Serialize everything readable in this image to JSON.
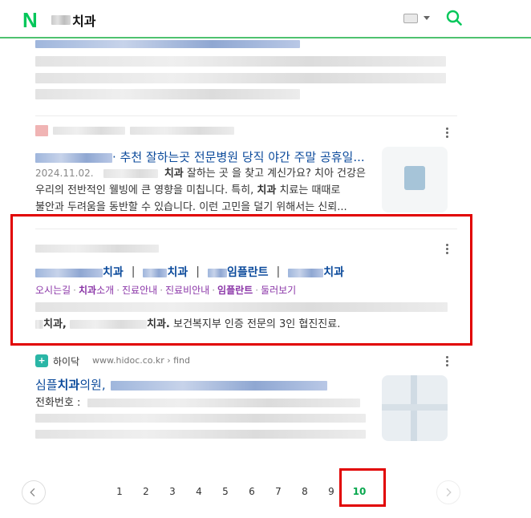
{
  "header": {
    "logo": "N",
    "query_suffix": "치과"
  },
  "result1": {
    "title_suffix": "· 추천 잘하는곳 전문병원 당직 야간 주말 공휴일...",
    "date": "2024.11.02.",
    "line1_bold": "치과",
    "line1_text": "잘하는 곳 을 찾고 계신가요? 치아 건강은",
    "line2": "우리의 전반적인 웰빙에 큰 영향을 미칩니다. 특히,",
    "line2_bold": "치과",
    "line2_tail": "치료는 때때로",
    "line3": "불안과 두려움을 동반할 수 있습니다. 이런 고민을 덜기 위해서는 신뢰..."
  },
  "result2": {
    "sitelinks": [
      "치과",
      "치과",
      "임플란트",
      "치과"
    ],
    "separator": "|",
    "sublinks": [
      {
        "text": "오시는길",
        "bold": false
      },
      {
        "text": "치과",
        "bold": true,
        "tail": "소개"
      },
      {
        "text": "진료안내",
        "bold": false
      },
      {
        "text": "진료비안내",
        "bold": false
      },
      {
        "text": "임플란트",
        "bold": true
      },
      {
        "text": "둘러보기",
        "bold": false
      }
    ],
    "sublink_sep": "·",
    "line2_bold_a": "치과,",
    "line2_bold_b": "치과.",
    "line2_text": "보건복지부 인증 전문의 3인 협진진료."
  },
  "result3": {
    "site_name": "하이닥",
    "site_url": "www.hidoc.co.kr › find",
    "title_prefix": "심플",
    "title_bold": "치과",
    "title_suffix": "의원,",
    "phone_label": "전화번호 :"
  },
  "pagination": {
    "pages": [
      "1",
      "2",
      "3",
      "4",
      "5",
      "6",
      "7",
      "8",
      "9",
      "10"
    ],
    "current": "10"
  },
  "colors": {
    "brand": "#03c75a",
    "link": "#0b4a9b",
    "visited": "#8b36a8",
    "highlight": "#e10000"
  }
}
